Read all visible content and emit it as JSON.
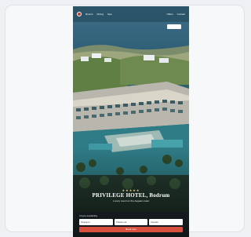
{
  "nav": {
    "links": [
      "Rooms",
      "Dining",
      "Spa"
    ],
    "right_links": [
      "Offers",
      "Contact"
    ],
    "reserve_label": ""
  },
  "hero": {
    "stars": "★★★★★",
    "title": "PRIVILEGE HOTEL, Bodrum",
    "subtitle": "Luxury resort on the Aegean coast"
  },
  "booking": {
    "label": "Check availability",
    "fields": [
      "Check-in",
      "Check-out",
      "Guests"
    ],
    "cta_label": "Book now"
  },
  "colors": {
    "accent": "#d8513f",
    "sea": "#2f6f86",
    "overlay": "#14181f"
  }
}
